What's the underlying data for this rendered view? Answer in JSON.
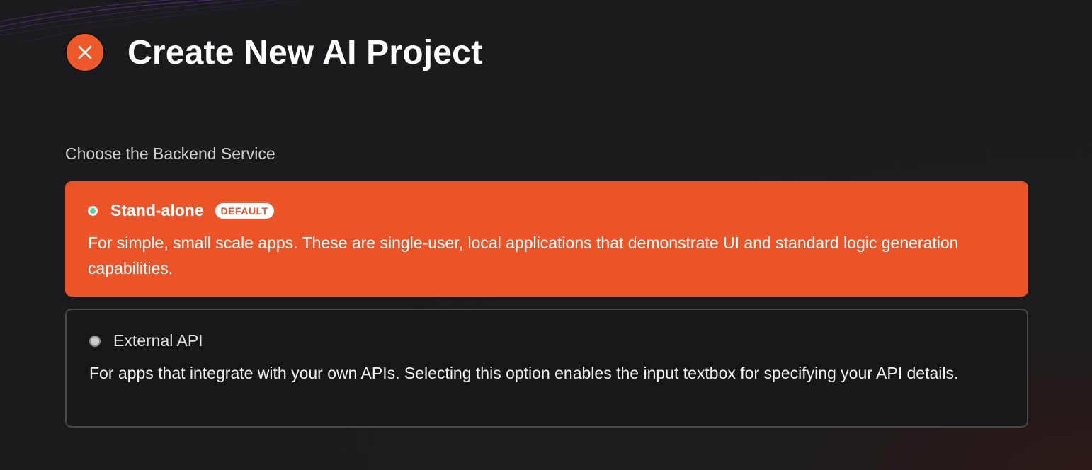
{
  "header": {
    "title": "Create New AI Project",
    "close_icon": "close-icon"
  },
  "backend": {
    "label": "Choose the Backend Service",
    "options": [
      {
        "title": "Stand-alone",
        "badge": "DEFAULT",
        "description": "For simple, small scale apps. These are single-user, local applications that demonstrate UI and standard logic generation capabilities.",
        "selected": true
      },
      {
        "title": "External API",
        "description": "For apps that integrate with your own APIs. Selecting this option enables the input textbox for specifying your API details.",
        "selected": false
      }
    ]
  },
  "colors": {
    "accent": "#ea5428",
    "background": "#1b1b1d",
    "card_border": "#4a4a4c",
    "radio_selected": "#4fd59a"
  }
}
